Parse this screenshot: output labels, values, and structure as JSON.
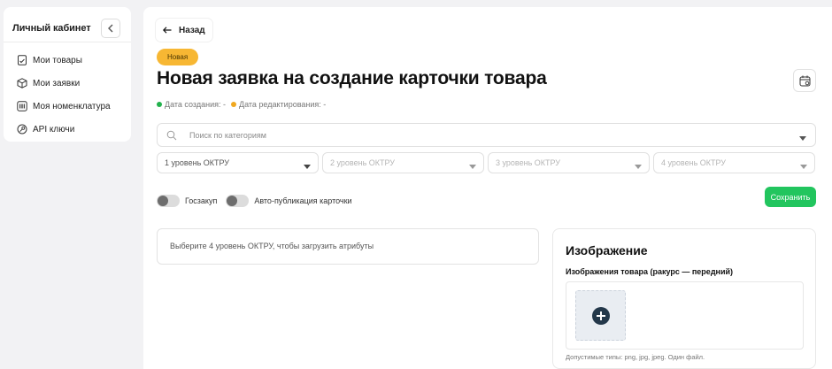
{
  "sidebar": {
    "title": "Личный кабинет",
    "items": [
      {
        "label": "Мои товары",
        "icon": "file-list-icon"
      },
      {
        "label": "Мои заявки",
        "icon": "box-icon"
      },
      {
        "label": "Моя номенклатура",
        "icon": "barcode-icon"
      },
      {
        "label": "API ключи",
        "icon": "key-icon"
      }
    ]
  },
  "header": {
    "back_label": "Назад",
    "status_badge": "Новая",
    "title": "Новая заявка на создание карточки товара",
    "created_label": "Дата создания: -",
    "edited_label": "Дата редактирования: -"
  },
  "form": {
    "category_search_placeholder": "Поиск по категориям",
    "okpd_levels": [
      {
        "placeholder": "1 уровень ОКТРУ",
        "enabled": true
      },
      {
        "placeholder": "2 уровень ОКТРУ",
        "enabled": false
      },
      {
        "placeholder": "3 уровень ОКТРУ",
        "enabled": false
      },
      {
        "placeholder": "4 уровень ОКТРУ",
        "enabled": false
      }
    ],
    "toggle_goszakup": "Госзакуп",
    "toggle_autopublish": "Авто-публикация карточки",
    "save_label": "Сохранить",
    "attributes_hint": "Выберите 4 уровень ОКТРУ, чтобы загрузить атрибуты"
  },
  "image_panel": {
    "title": "Изображение",
    "subtitle": "Изображения товара (ракурс — передний)",
    "hint": "Допустимые типы: png, jpg, jpeg. Один файл."
  },
  "colors": {
    "accent_green": "#22c55e",
    "badge_yellow": "#f7b733",
    "created_dot": "#22b14c",
    "edited_dot": "#f0a820"
  }
}
